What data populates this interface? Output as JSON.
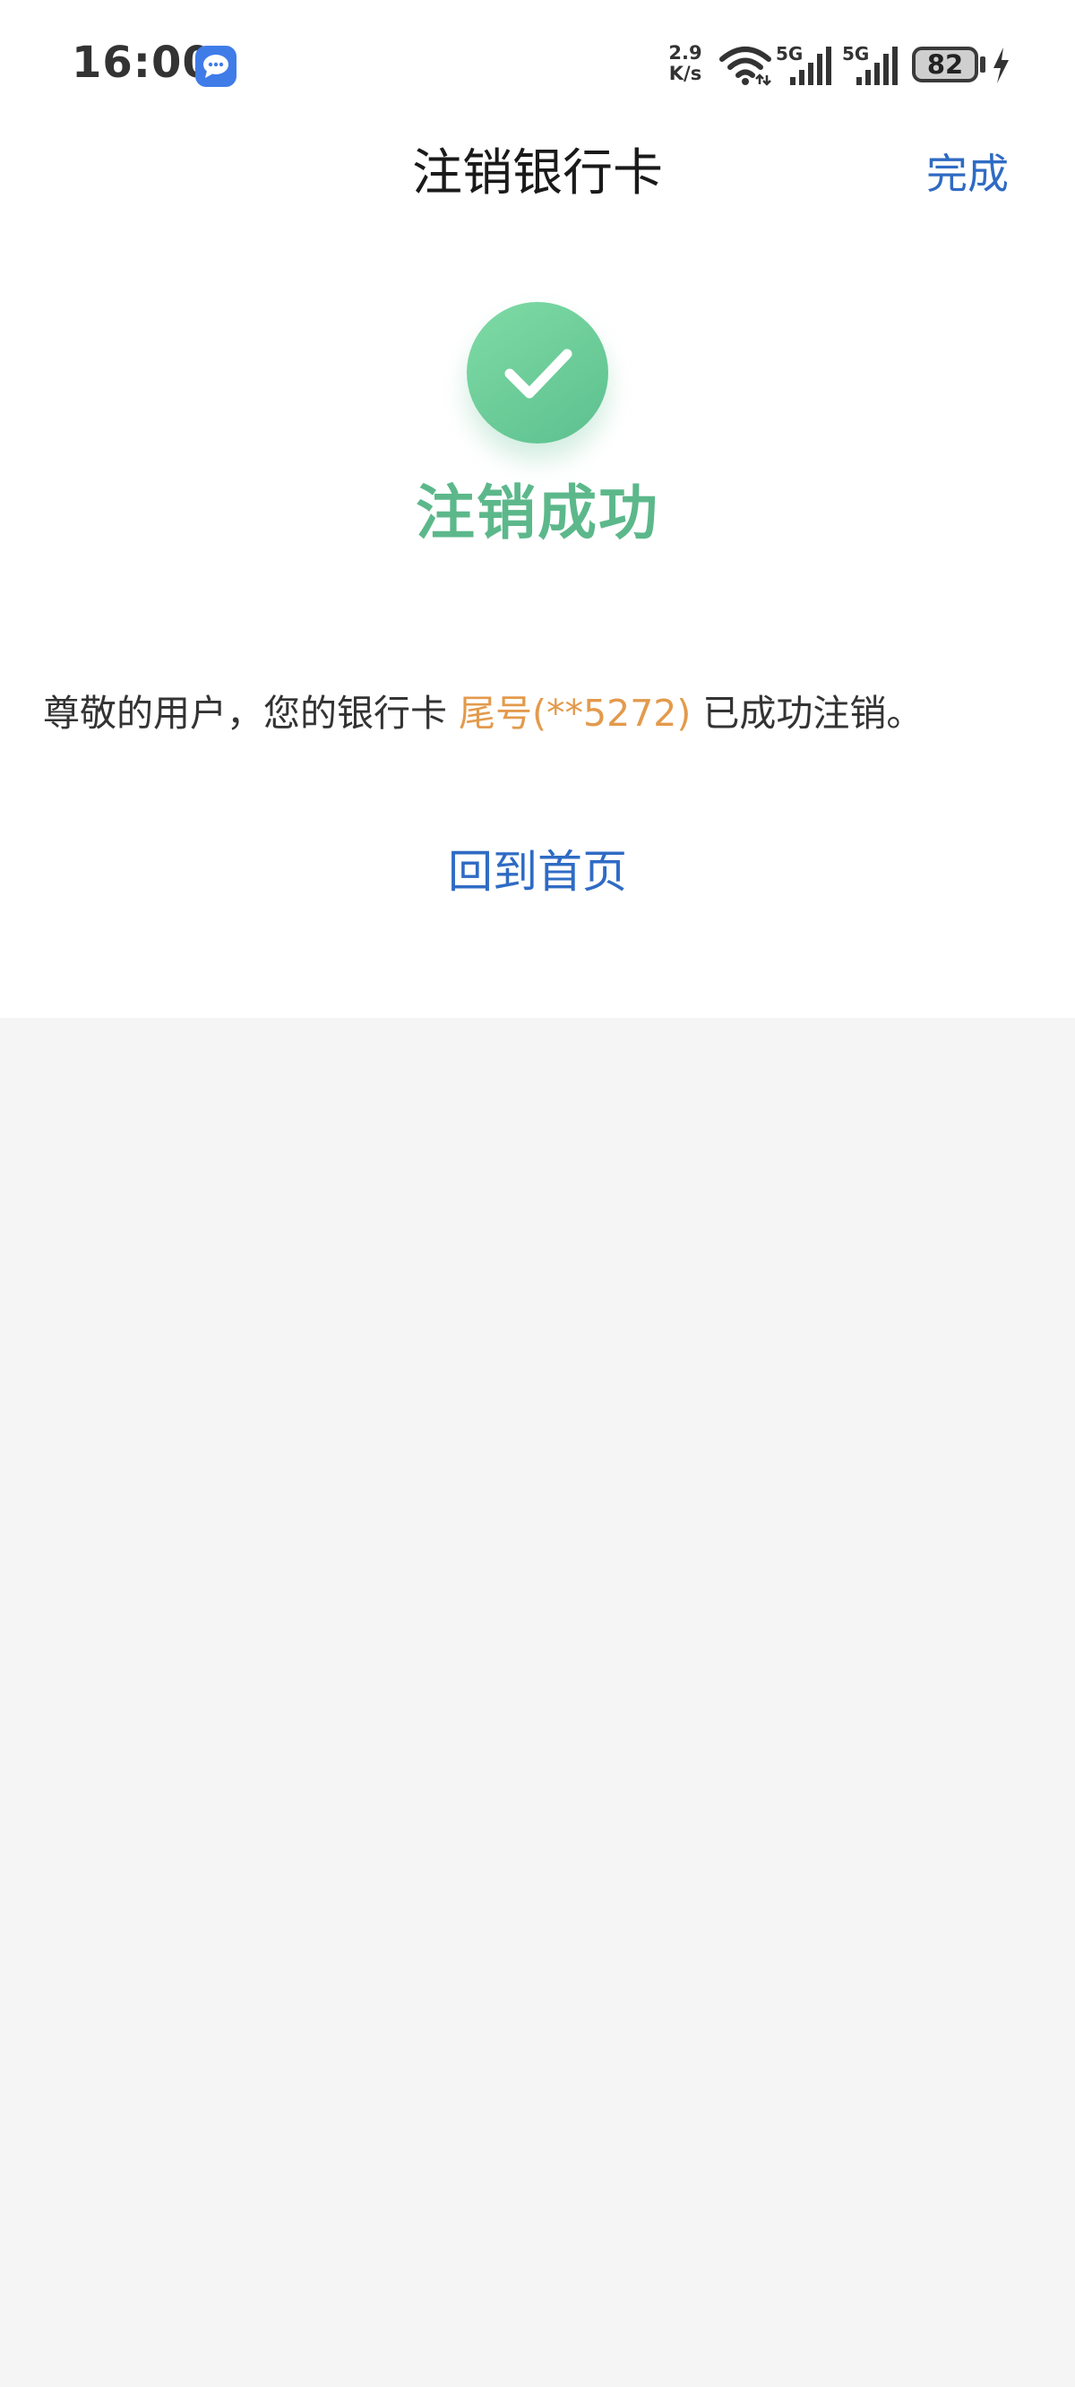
{
  "status_bar": {
    "time": "16:00",
    "net_speed_value": "2.9",
    "net_speed_unit": "K/s",
    "signal_label_1": "5G",
    "signal_label_2": "5G",
    "battery_level": "82"
  },
  "header": {
    "title": "注销银行卡",
    "done_label": "完成"
  },
  "result": {
    "title": "注销成功",
    "message_prefix": "尊敬的用户，您的银行卡 ",
    "card_tail": "尾号(**5272)",
    "message_suffix": " 已成功注销。"
  },
  "actions": {
    "home_label": "回到首页"
  },
  "colors": {
    "accent_blue": "#2f6bc4",
    "success_green": "#5cb88b",
    "highlight_orange": "#e39a4c",
    "background_gray": "#f5f5f5"
  },
  "icons": {
    "message_app": "chat-bubble-icon",
    "wifi": "wifi-icon",
    "signal": "cellular-signal-icon",
    "charging": "charging-bolt-icon",
    "success": "checkmark-icon"
  }
}
